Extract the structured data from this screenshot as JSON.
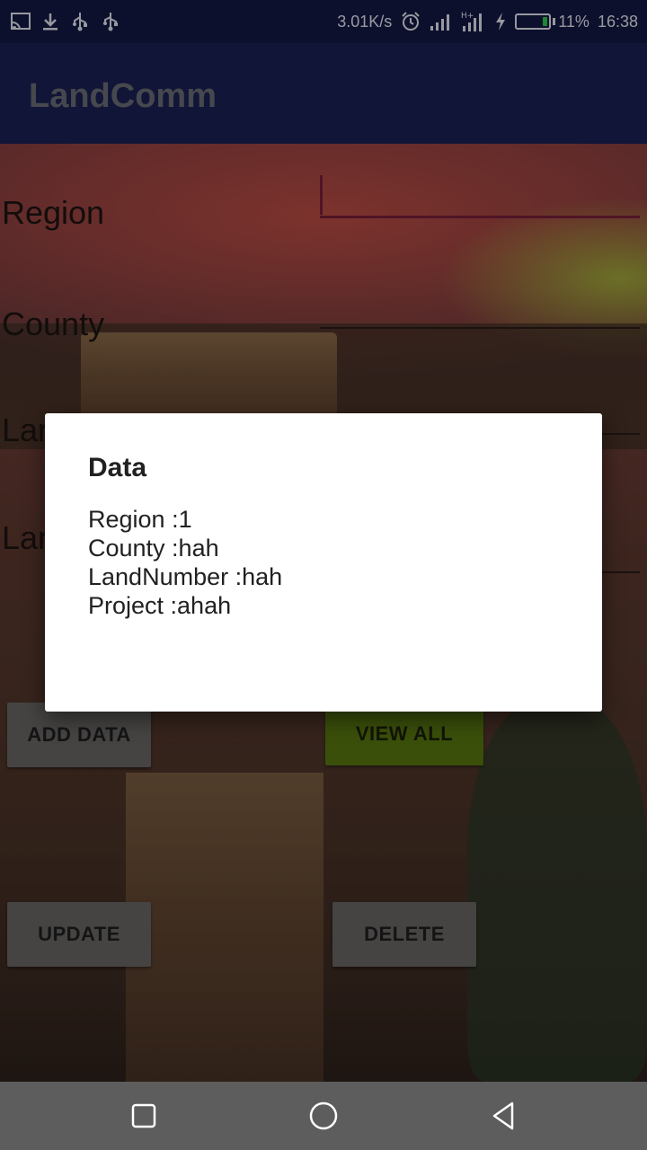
{
  "status_bar": {
    "speed": "3.01K/s",
    "battery": "11%",
    "time": "16:38",
    "icons": [
      "cast-icon",
      "download-icon",
      "usb-icon",
      "usb-icon",
      "alarm-icon",
      "signal-icon",
      "signal-h-plus-icon",
      "charging-icon",
      "battery-icon"
    ]
  },
  "app_bar": {
    "title": "LandComm"
  },
  "form": {
    "region_label": "Region",
    "county_label": "County",
    "land_label": "Lar",
    "project_label": "Lar"
  },
  "buttons": {
    "add_data": "ADD DATA",
    "view_all": "VIEW ALL",
    "update": "UPDATE",
    "delete": "DELETE"
  },
  "dialog": {
    "title": "Data",
    "lines": [
      "Region :1",
      "County :hah",
      "LandNumber :hah",
      "Project :ahah"
    ]
  },
  "nav_bar": {
    "icons": [
      "recents-square-icon",
      "home-circle-icon",
      "back-triangle-icon"
    ]
  },
  "colors": {
    "status_bar": "#141a45",
    "app_bar": "#1b2257",
    "accent": "#7a1f3a",
    "view_all": "#5a7a10",
    "button": "#6b6968",
    "nav_bar": "#5d5d5d"
  }
}
